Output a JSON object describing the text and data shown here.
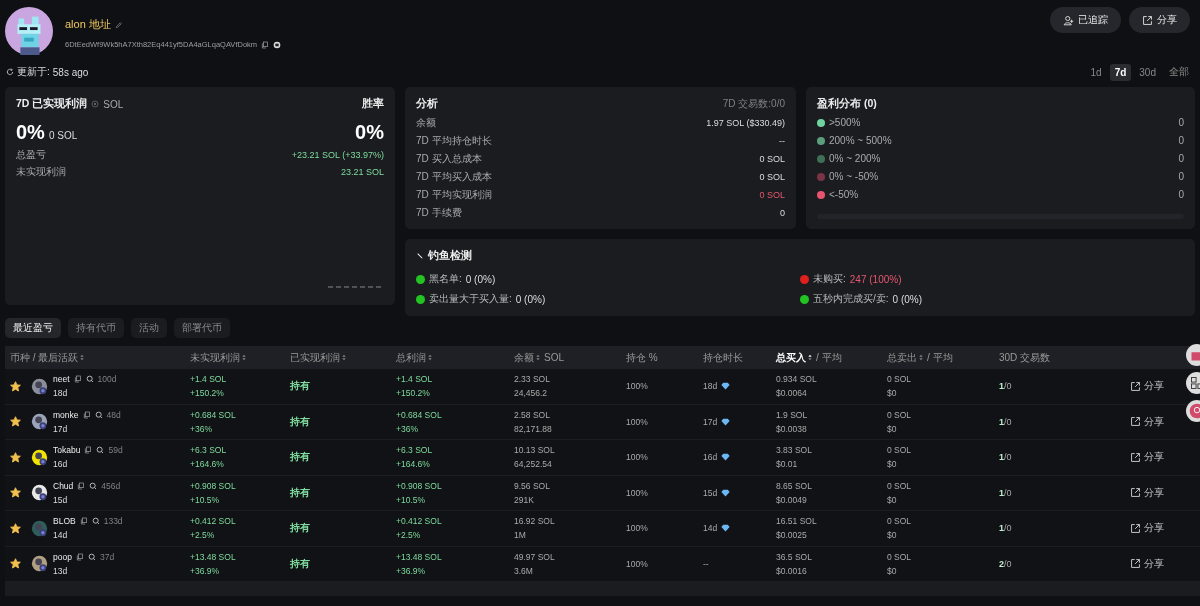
{
  "profile": {
    "name": "alon 地址",
    "address": "6DtEedWf9Wk5hA7Xth82Eq441yf5DA4aGLqaQAVfDokm",
    "updated_label": "更新于:",
    "updated_value": "58s ago"
  },
  "actions": [
    {
      "label": "已追踪",
      "kind": "follow"
    },
    {
      "label": "分享",
      "kind": "share"
    }
  ],
  "periods": [
    {
      "label": "1d",
      "selected": false
    },
    {
      "label": "7d",
      "selected": true
    },
    {
      "label": "30d",
      "selected": false
    },
    {
      "label": "全部",
      "selected": false
    }
  ],
  "pnl_card": {
    "title": "7D 已实现利润",
    "currency": "SOL",
    "winrate_label": "胜率",
    "pnl_pct": "0%",
    "pnl_sol": "0 SOL",
    "winrate": "0%",
    "rows": [
      {
        "label": "总盈亏",
        "value": "+23.21 SOL (+33.97%)"
      },
      {
        "label": "未实现利润",
        "value": "23.21 SOL"
      }
    ]
  },
  "analysis": {
    "title": "分析",
    "trades": "7D 交易数:0/0",
    "rows": [
      {
        "label": "余额",
        "value": "1.97 SOL ($330.49)",
        "negative": false
      },
      {
        "label": "7D 平均持仓时长",
        "value": "--",
        "negative": false
      },
      {
        "label": "7D 买入总成本",
        "value": "0 SOL",
        "negative": false
      },
      {
        "label": "7D 平均买入成本",
        "value": "0 SOL",
        "negative": false
      },
      {
        "label": "7D 平均实现利润",
        "value": "0 SOL",
        "negative": true
      },
      {
        "label": "7D 手续费",
        "value": "0",
        "negative": false
      }
    ]
  },
  "distribution": {
    "title": "盈利分布 (0)",
    "items": [
      {
        "label": ">500%",
        "count": "0",
        "color": "#6fd3a0"
      },
      {
        "label": "200% ~ 500%",
        "count": "0",
        "color": "#5a9e7c"
      },
      {
        "label": "0% ~ 200%",
        "count": "0",
        "color": "#3f7057"
      },
      {
        "label": "0% ~ -50%",
        "count": "0",
        "color": "#7a3445"
      },
      {
        "label": "<-50%",
        "count": "0",
        "color": "#e8536e"
      }
    ]
  },
  "phishing": {
    "title": "钓鱼检测",
    "items": [
      {
        "label": "黑名单:",
        "value": "0 (0%)",
        "color": "#22c322",
        "negative": false
      },
      {
        "label": "未购买:",
        "value": "247 (100%)",
        "color": "#e0201c",
        "negative": true
      },
      {
        "label": "卖出量大于买入量:",
        "value": "0 (0%)",
        "color": "#22c322",
        "negative": false
      },
      {
        "label": "五秒内完成买/卖:",
        "value": "0 (0%)",
        "color": "#22c322",
        "negative": false
      }
    ]
  },
  "tabs": [
    {
      "label": "最近盈亏",
      "selected": true
    },
    {
      "label": "持有代币",
      "selected": false
    },
    {
      "label": "活动",
      "selected": false
    },
    {
      "label": "部署代币",
      "selected": false
    }
  ],
  "table": {
    "columns": [
      {
        "label": "币种 / 最后活跃",
        "sortable": true,
        "active": false
      },
      {
        "label": "未实现利润",
        "sortable": true,
        "active": false
      },
      {
        "label": "已实现利润",
        "sortable": true,
        "active": false
      },
      {
        "label": "总利润",
        "sortable": true,
        "active": false
      },
      {
        "label": "余额",
        "sub": "SOL",
        "sortable": true,
        "active": false
      },
      {
        "label": "持仓 %",
        "sortable": false,
        "active": false
      },
      {
        "label": "持仓时长",
        "sortable": false,
        "active": false
      },
      {
        "label": "总买入",
        "sub": "/ 平均",
        "sortable": true,
        "active": true
      },
      {
        "label": "总卖出",
        "sub": "/ 平均",
        "sortable": true,
        "active": false
      },
      {
        "label": "30D 交易数",
        "sortable": false,
        "active": false
      }
    ],
    "rows": [
      {
        "starred": true,
        "name": "neet",
        "age": "100d",
        "last": "18d",
        "unreal": "+1.4 SOL",
        "unreal_pct": "+150.2%",
        "realized": "持有",
        "total": "+1.4 SOL",
        "total_pct": "+150.2%",
        "bal": "2.33 SOL",
        "amount": "24,456.2",
        "hold": "100%",
        "dur": "18d",
        "diamond": true,
        "buy": "0.934 SOL",
        "buy_avg": "$0.0064",
        "sell": "0 SOL",
        "sell_avg": "$0",
        "tx_buy": "1",
        "tx_sell": "/0",
        "share": "分享"
      },
      {
        "starred": true,
        "name": "monke",
        "age": "48d",
        "last": "17d",
        "unreal": "+0.684 SOL",
        "unreal_pct": "+36%",
        "realized": "持有",
        "total": "+0.684 SOL",
        "total_pct": "+36%",
        "bal": "2.58 SOL",
        "amount": "82,171.88",
        "hold": "100%",
        "dur": "17d",
        "diamond": true,
        "buy": "1.9 SOL",
        "buy_avg": "$0.0038",
        "sell": "0 SOL",
        "sell_avg": "$0",
        "tx_buy": "1",
        "tx_sell": "/0",
        "share": "分享"
      },
      {
        "starred": true,
        "name": "Tokabu",
        "age": "59d",
        "last": "16d",
        "unreal": "+6.3 SOL",
        "unreal_pct": "+164.6%",
        "realized": "持有",
        "total": "+6.3 SOL",
        "total_pct": "+164.6%",
        "bal": "10.13 SOL",
        "amount": "64,252.54",
        "hold": "100%",
        "dur": "16d",
        "diamond": true,
        "buy": "3.83 SOL",
        "buy_avg": "$0.01",
        "sell": "0 SOL",
        "sell_avg": "$0",
        "tx_buy": "1",
        "tx_sell": "/0",
        "share": "分享"
      },
      {
        "starred": true,
        "name": "Chud",
        "age": "456d",
        "last": "15d",
        "unreal": "+0.908 SOL",
        "unreal_pct": "+10.5%",
        "realized": "持有",
        "total": "+0.908 SOL",
        "total_pct": "+10.5%",
        "bal": "9.56 SOL",
        "amount": "291K",
        "hold": "100%",
        "dur": "15d",
        "diamond": true,
        "buy": "8.65 SOL",
        "buy_avg": "$0.0049",
        "sell": "0 SOL",
        "sell_avg": "$0",
        "tx_buy": "1",
        "tx_sell": "/0",
        "share": "分享"
      },
      {
        "starred": true,
        "name": "BLOB",
        "age": "133d",
        "last": "14d",
        "unreal": "+0.412 SOL",
        "unreal_pct": "+2.5%",
        "realized": "持有",
        "total": "+0.412 SOL",
        "total_pct": "+2.5%",
        "bal": "16.92 SOL",
        "amount": "1M",
        "hold": "100%",
        "dur": "14d",
        "diamond": true,
        "buy": "16.51 SOL",
        "buy_avg": "$0.0025",
        "sell": "0 SOL",
        "sell_avg": "$0",
        "tx_buy": "1",
        "tx_sell": "/0",
        "share": "分享"
      },
      {
        "starred": true,
        "name": "poop",
        "age": "37d",
        "last": "13d",
        "unreal": "+13.48 SOL",
        "unreal_pct": "+36.9%",
        "realized": "持有",
        "total": "+13.48 SOL",
        "total_pct": "+36.9%",
        "bal": "49.97 SOL",
        "amount": "3.6M",
        "hold": "100%",
        "dur": "--",
        "diamond": false,
        "buy": "36.5 SOL",
        "buy_avg": "$0.0016",
        "sell": "0 SOL",
        "sell_avg": "$0",
        "tx_buy": "2",
        "tx_sell": "/0",
        "share": "分享"
      }
    ]
  }
}
